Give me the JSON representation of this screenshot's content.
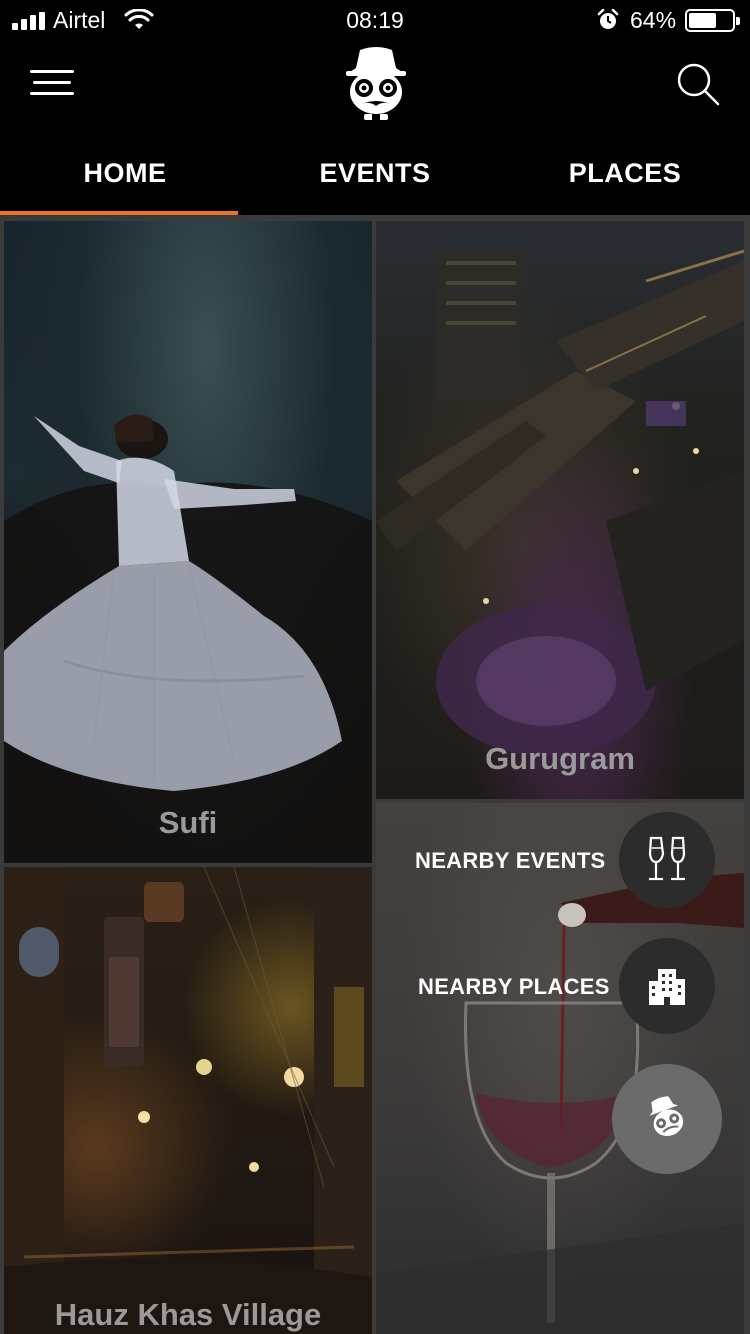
{
  "status_bar": {
    "carrier": "Airtel",
    "time": "08:19",
    "battery_percent": "64%",
    "battery_level": 0.64
  },
  "header": {
    "menu_icon": "hamburger-menu-icon",
    "logo_icon": "mascot-logo-icon",
    "search_icon": "search-icon"
  },
  "tabs": [
    {
      "label": "HOME",
      "active": true
    },
    {
      "label": "EVENTS",
      "active": false
    },
    {
      "label": "PLACES",
      "active": false
    }
  ],
  "accent_color": "#e8732a",
  "tiles": [
    {
      "label": "Sufi"
    },
    {
      "label": "Gurugram"
    },
    {
      "label": "Hauz Khas Village"
    },
    {
      "label": ""
    }
  ],
  "fab_menu": {
    "nearby_events_label": "NEARBY EVENTS",
    "nearby_events_icon": "champagne-glasses-icon",
    "nearby_places_label": "NEARBY PLACES",
    "nearby_places_icon": "building-icon",
    "main_icon": "mascot-close-icon"
  }
}
